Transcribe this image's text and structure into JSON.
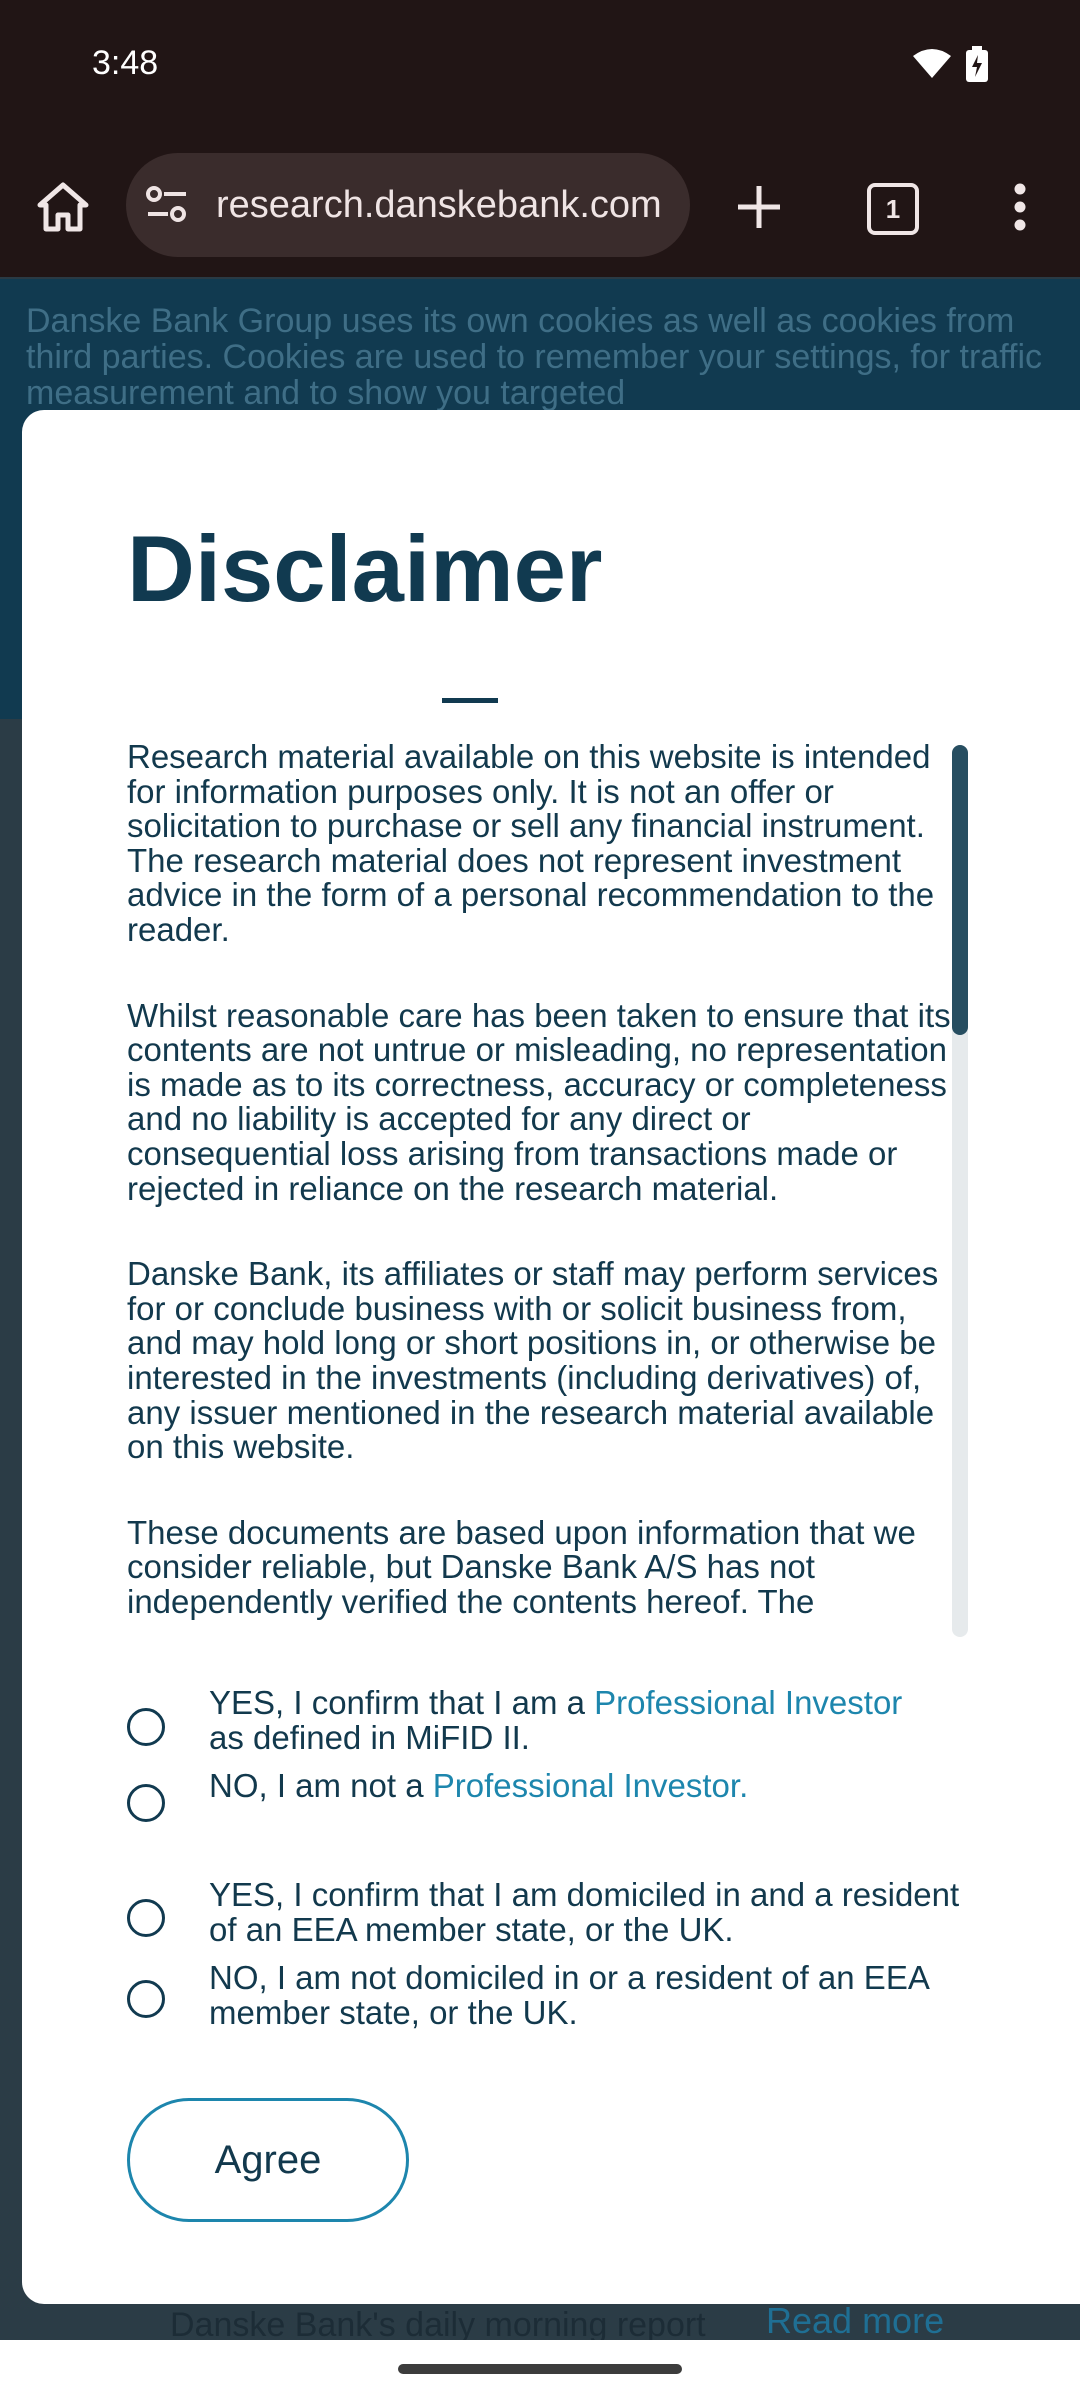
{
  "status_bar": {
    "time": "3:48"
  },
  "browser": {
    "url": "research.danskebank.com",
    "tab_count": "1",
    "load_progress_percent": 70
  },
  "page": {
    "cookie_banner_text": "Danske Bank Group uses its own cookies as well as cookies from third parties. Cookies are used to remember your settings, for traffic measurement and to show you targeted",
    "morning_report_text": "Danske Bank's daily morning report",
    "read_more_label": "Read more"
  },
  "modal": {
    "title": "Disclaimer",
    "paragraphs": [
      "Research material available on this website is intended for information purposes only. It is not an offer or solicitation to purchase or sell any financial instrument. The research material does not represent investment advice in the form of a personal recommendation to the reader.",
      "Whilst reasonable care has been taken to ensure that its contents are not untrue or misleading, no representation is made as to its correctness, accuracy or completeness and no liability is accepted for any direct or consequential loss arising from transactions made or rejected in reliance on the research material.",
      "Danske Bank, its affiliates or staff may perform services for or conclude business with or solicit business from, and may hold long or short positions in, or otherwise be interested in the investments (including derivatives) of, any issuer mentioned in the research material available on this website.",
      "These documents are based upon information that we consider reliable, but Danske Bank A/S has not independently verified the contents hereof. The"
    ],
    "options": {
      "pro_yes_prefix": "YES, I confirm that I am a ",
      "pro_yes_link": "Professional Investor",
      "pro_yes_suffix": "as defined in MiFID II.",
      "pro_no_prefix": "NO, I am not a ",
      "pro_no_link": "Professional Investor.",
      "eea_yes": "YES, I confirm that I am domiciled in and a resident of an EEA member state, or the UK.",
      "eea_no": "NO, I am not domiciled in or a resident of an EEA member state, or the UK."
    },
    "agree_label": "Agree"
  }
}
